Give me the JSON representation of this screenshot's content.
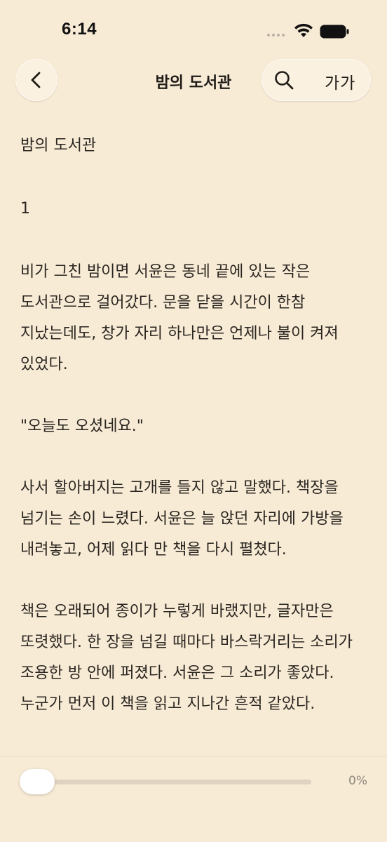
{
  "status_bar": {
    "time": "6:14"
  },
  "nav": {
    "title": "밤의 도서관",
    "font_size_label": "가가",
    "back_icon": "chevron-left-icon",
    "search_icon": "search-icon"
  },
  "content": {
    "book_title": "밤의 도서관",
    "chapter": "1",
    "paragraphs": [
      "비가 그친 밤이면 서윤은 동네 끝에 있는 작은 도서관으로 걸어갔다. 문을 닫을 시간이 한참 지났는데도, 창가 자리 하나만은 언제나 불이 켜져 있었다.",
      "\"오늘도 오셨네요.\"",
      "사서 할아버지는 고개를 들지 않고 말했다. 책장을 넘기는 손이 느렸다. 서윤은 늘 앉던 자리에 가방을 내려놓고, 어제 읽다 만 책을 다시 펼쳤다.",
      "책은 오래되어 종이가 누렇게 바랬지만, 글자만은 또렷했다. 한 장을 넘길 때마다 바스락거리는 소리가 조용한 방 안에 퍼졌다. 서윤은 그 소리가 좋았다. 누군가 먼저 이 책을 읽고 지나간 흔적 같았다."
    ]
  },
  "progress": {
    "value": 0,
    "label": "0%"
  },
  "colors": {
    "background": "#f8ebd6",
    "button_bg": "#fbf1e0",
    "text": "#2a2620",
    "track": "#dfd3c1"
  }
}
